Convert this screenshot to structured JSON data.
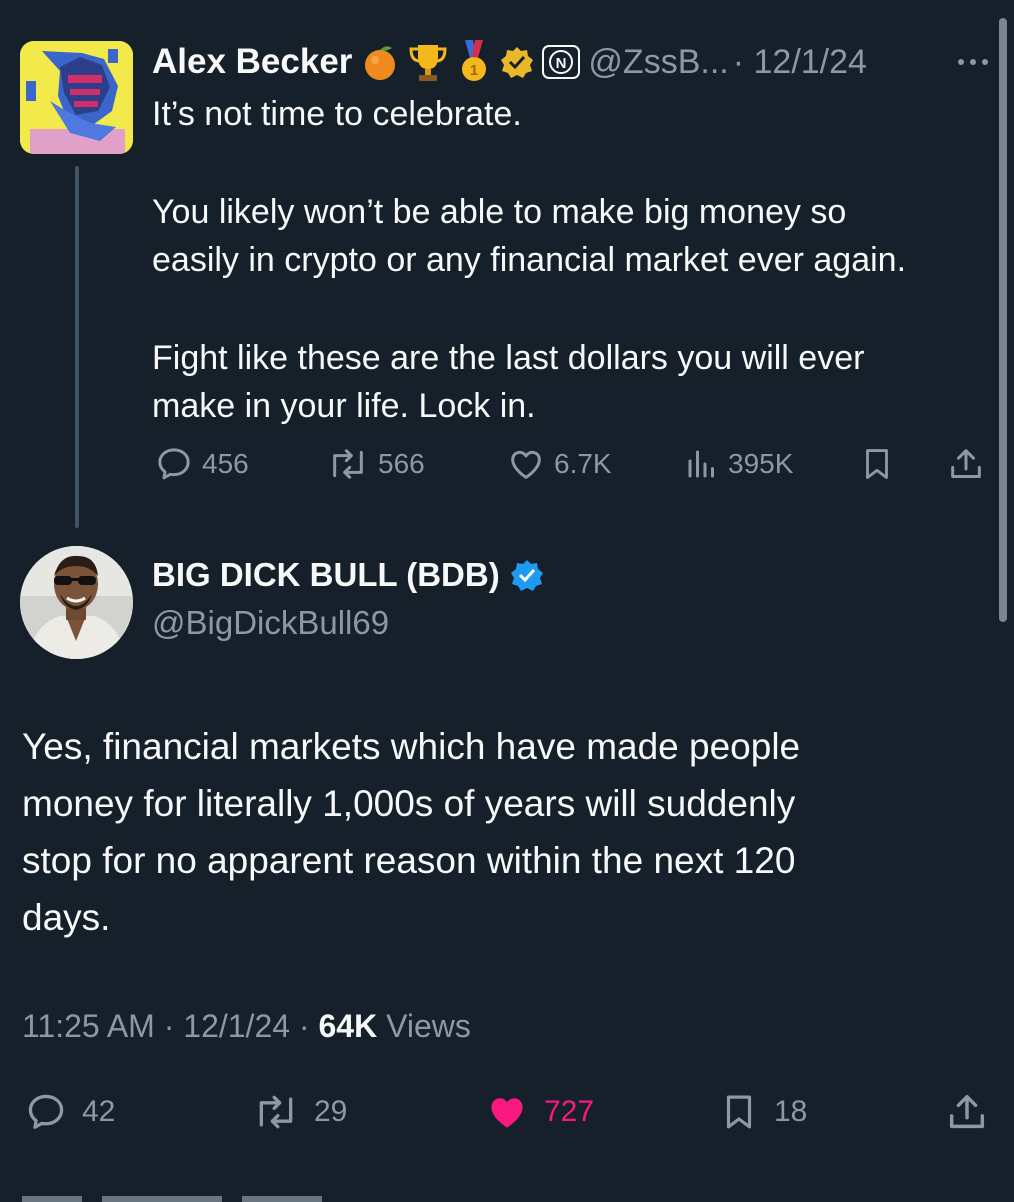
{
  "parent_tweet": {
    "author_name": "Alex Becker",
    "badges": [
      "orange-emoji",
      "trophy-emoji",
      "first-place-medal-emoji",
      "gold-verified-badge",
      "affiliate-badge"
    ],
    "handle": "@ZssB...",
    "date": "· 12/1/24",
    "body": [
      "It’s not time to celebrate.",
      "You likely won’t be able to make big money so",
      "easily in crypto or any financial market ever again.",
      "Fight like these are the last dollars you will ever",
      "make in your life. Lock in."
    ],
    "stats": {
      "replies": "456",
      "reposts": "566",
      "likes": "6.7K",
      "views": "395K"
    }
  },
  "main_tweet": {
    "author_name": "BIG DICK BULL (BDB)",
    "handle": "@BigDickBull69",
    "verified_color": "#1d9bf0",
    "body": [
      "Yes, financial markets which have made people",
      "money for literally 1,000s of years will suddenly",
      "stop for no apparent reason within the next 120",
      "days."
    ],
    "time": "11:25 AM",
    "date": "· 12/1/24 ·",
    "views_count": "64K",
    "views_label": "Views",
    "stats": {
      "replies": "42",
      "reposts": "29",
      "likes": "727",
      "bookmarks": "18"
    }
  },
  "colors": {
    "background": "#15202b",
    "text": "#f7f9f9",
    "secondary_text": "#8b98a5",
    "like_pink": "#f91880",
    "verified_blue": "#1d9bf0",
    "gold_badge": "#e8b829"
  }
}
